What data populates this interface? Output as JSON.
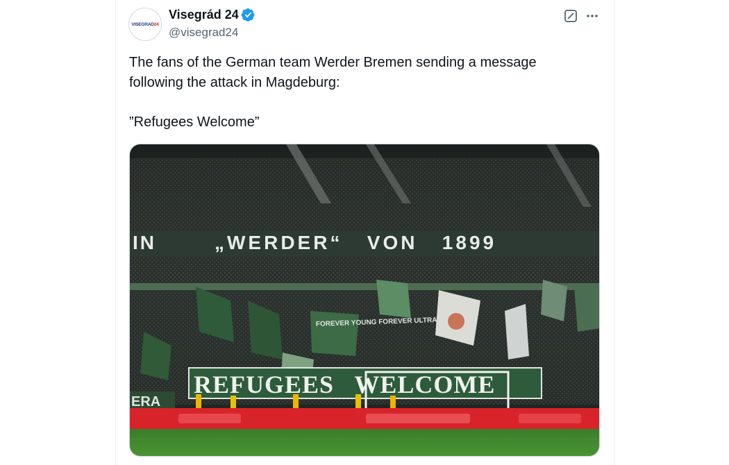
{
  "author": {
    "display_name": "Visegrád 24",
    "handle": "@visegrad24",
    "avatar_text_main": "VISEGRAD",
    "avatar_text_num": "24",
    "verified": true
  },
  "tweet": {
    "text": "The fans of the German team Werder Bremen sending a message following the attack in Magdeburg:\n\n”Refugees Welcome”"
  },
  "media": {
    "banner_top": "„WERDER“   VON   1899",
    "banner_top_left": "IN",
    "banner_bottom": "REFUGEES   WELCOME",
    "banner_left": "ERA",
    "flag_text": "FOREVER YOUNG FOREVER ULTRAS"
  },
  "colors": {
    "verified": "#1d9bf0",
    "text": "#0f1419",
    "muted": "#536471",
    "pitch": "#3f8a2e",
    "adboard": "#d9232a"
  },
  "icons": {
    "verified": "verified-badge-icon",
    "grok": "grok-icon",
    "more": "more-icon"
  }
}
